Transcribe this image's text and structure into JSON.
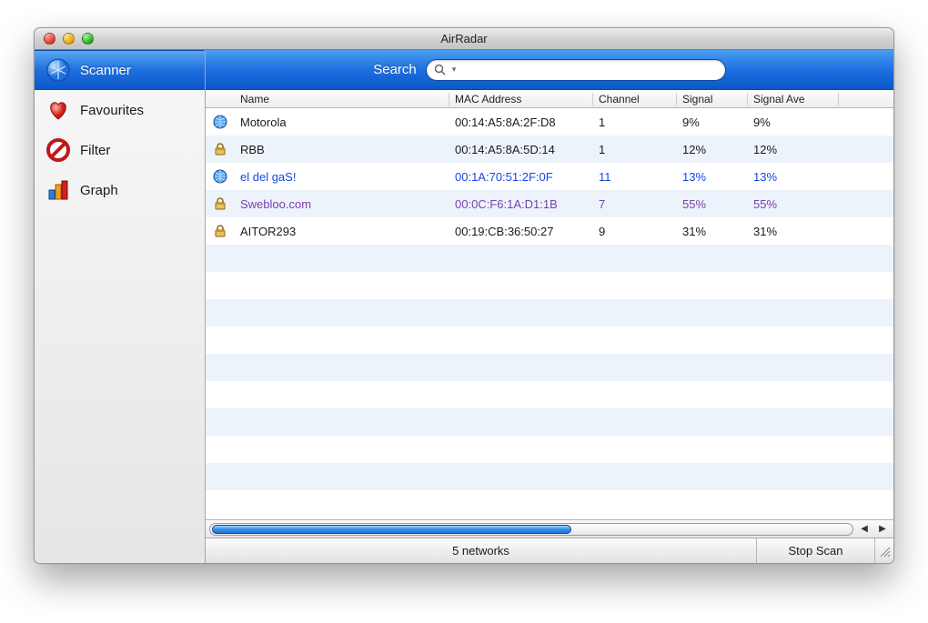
{
  "window": {
    "title": "AirRadar"
  },
  "sidebar": {
    "items": [
      {
        "label": "Scanner",
        "icon": "scanner-globe-icon",
        "selected": true
      },
      {
        "label": "Favourites",
        "icon": "heart-icon",
        "selected": false
      },
      {
        "label": "Filter",
        "icon": "nodeny-icon",
        "selected": false
      },
      {
        "label": "Graph",
        "icon": "barchart-icon",
        "selected": false
      }
    ]
  },
  "search": {
    "label": "Search",
    "placeholder": ""
  },
  "columns": {
    "name": "Name",
    "mac": "MAC Address",
    "channel": "Channel",
    "signal": "Signal",
    "signal_avg": "Signal Ave"
  },
  "networks": [
    {
      "name": "Motorola",
      "mac": "00:14:A5:8A:2F:D8",
      "channel": "1",
      "signal": "9%",
      "signal_avg": "9%",
      "icon": "open-network-icon",
      "style": "normal"
    },
    {
      "name": "RBB",
      "mac": "00:14:A5:8A:5D:14",
      "channel": "1",
      "signal": "12%",
      "signal_avg": "12%",
      "icon": "locked-network-icon",
      "style": "normal"
    },
    {
      "name": "el del gaS!",
      "mac": "00:1A:70:51:2F:0F",
      "channel": "11",
      "signal": "13%",
      "signal_avg": "13%",
      "icon": "open-network-icon",
      "style": "blue"
    },
    {
      "name": "Swebloo.com",
      "mac": "00:0C:F6:1A:D1:1B",
      "channel": "7",
      "signal": "55%",
      "signal_avg": "55%",
      "icon": "locked-network-icon",
      "style": "purple"
    },
    {
      "name": "AITOR293",
      "mac": "00:19:CB:36:50:27",
      "channel": "9",
      "signal": "31%",
      "signal_avg": "31%",
      "icon": "locked-network-icon",
      "style": "normal"
    }
  ],
  "status": {
    "count_text": "5 networks",
    "scan_button": "Stop Scan"
  }
}
